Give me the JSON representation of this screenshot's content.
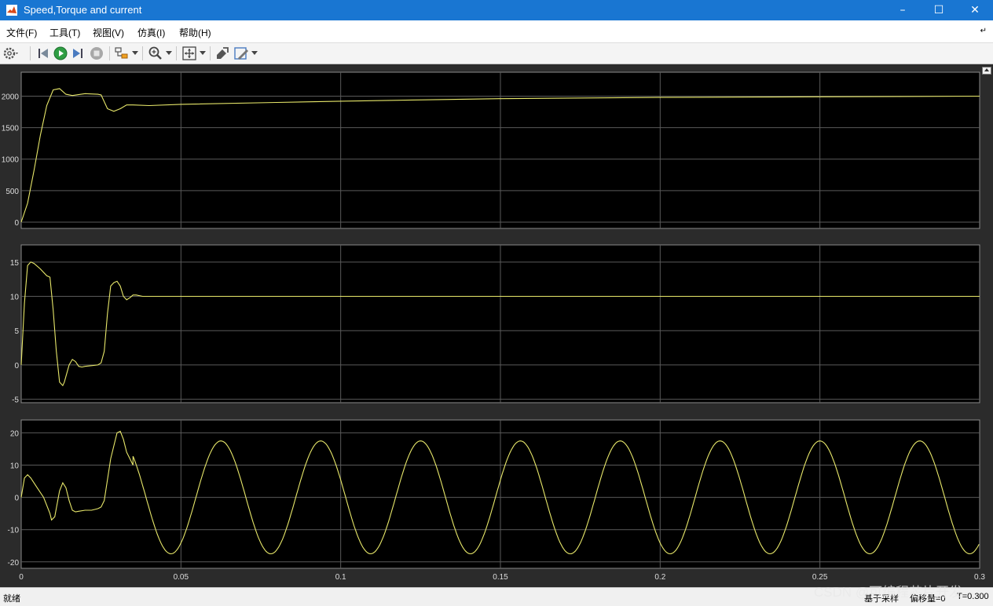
{
  "window": {
    "title": "Speed,Torque and current"
  },
  "menu": [
    "文件(F)",
    "工具(T)",
    "视图(V)",
    "仿真(I)",
    "帮助(H)"
  ],
  "toolbar": [
    "gear-icon",
    "step-back-icon",
    "run-icon",
    "step-forward-icon",
    "stop-icon",
    "signal-select-icon",
    "zoom-icon",
    "fit-to-view-icon",
    "highlight-block-icon",
    "style-icon"
  ],
  "colors": {
    "titlebar": "#1976d2",
    "signal": "#e8e86a",
    "plot_bg": "#000000",
    "grid": "#5a5a5a",
    "tick_text": "#dddddd"
  },
  "chart_data": [
    {
      "type": "line",
      "x": [
        0,
        0.002,
        0.004,
        0.006,
        0.008,
        0.01,
        0.012,
        0.014,
        0.016,
        0.02,
        0.024,
        0.025,
        0.027,
        0.029,
        0.031,
        0.033,
        0.035,
        0.04,
        0.05,
        0.08,
        0.1,
        0.15,
        0.2,
        0.25,
        0.3
      ],
      "values": [
        0,
        300,
        820,
        1380,
        1850,
        2100,
        2120,
        2030,
        2010,
        2040,
        2030,
        2020,
        1800,
        1760,
        1800,
        1860,
        1860,
        1850,
        1870,
        1900,
        1920,
        1960,
        1980,
        1990,
        2000
      ],
      "yticks": [
        0,
        500,
        1000,
        1500,
        2000
      ],
      "ylim": [
        -100,
        2380
      ],
      "xlim": [
        0,
        0.3
      ],
      "grid": true
    },
    {
      "type": "line",
      "x": [
        0,
        0.001,
        0.002,
        0.003,
        0.004,
        0.006,
        0.008,
        0.009,
        0.01,
        0.011,
        0.012,
        0.013,
        0.0135,
        0.015,
        0.016,
        0.017,
        0.018,
        0.019,
        0.02,
        0.022,
        0.024,
        0.025,
        0.026,
        0.027,
        0.028,
        0.029,
        0.03,
        0.031,
        0.032,
        0.033,
        0.034,
        0.035,
        0.036,
        0.038,
        0.04,
        0.3
      ],
      "values": [
        0,
        9,
        14.5,
        15,
        14.8,
        14,
        13,
        12.8,
        8,
        2,
        -2.5,
        -3,
        -2.5,
        0,
        0.8,
        0.5,
        -0.2,
        -0.3,
        -0.2,
        -0.1,
        0,
        0.3,
        2,
        7.5,
        11.5,
        12,
        12.2,
        11.5,
        10,
        9.5,
        9.8,
        10.2,
        10.2,
        10,
        10,
        10
      ],
      "yticks": [
        -5,
        0,
        5,
        10,
        15
      ],
      "ylim": [
        -5.5,
        17.5
      ],
      "xlim": [
        0,
        0.3
      ],
      "grid": true
    },
    {
      "type": "line",
      "x": [
        0,
        0.001,
        0.002,
        0.003,
        0.005,
        0.007,
        0.009,
        0.0095,
        0.0105,
        0.012,
        0.013,
        0.014,
        0.015,
        0.016,
        0.017,
        0.018,
        0.02,
        0.022,
        0.024,
        0.025,
        0.026,
        0.028,
        0.03,
        0.031,
        0.032,
        0.033,
        0.034,
        0.035
      ],
      "values": [
        0,
        6,
        7,
        6,
        3,
        0,
        -5,
        -7,
        -6,
        2,
        4.5,
        3,
        -1,
        -4,
        -4.5,
        -4.3,
        -4,
        -4,
        -3.5,
        -3,
        -1,
        12,
        20,
        20.5,
        18,
        14,
        12,
        10
      ],
      "sine": {
        "from": 0.035,
        "to": 0.3,
        "amplitude": 17.5,
        "period": 0.03125,
        "ref_peak": 0.0625
      },
      "yticks": [
        -20,
        -10,
        0,
        10,
        20
      ],
      "ylim": [
        -22,
        24
      ],
      "xlim": [
        0,
        0.3
      ],
      "xticks": [
        "0",
        "0.05",
        "0.1",
        "0.15",
        "0.2",
        "0.25",
        "0.3"
      ],
      "grid": true
    }
  ],
  "status": {
    "left": "就绪",
    "sample": "基于采样",
    "offset": "偏移量=0",
    "time": "T=0.300"
  },
  "watermark": "CSDN @可编程芯片开发"
}
